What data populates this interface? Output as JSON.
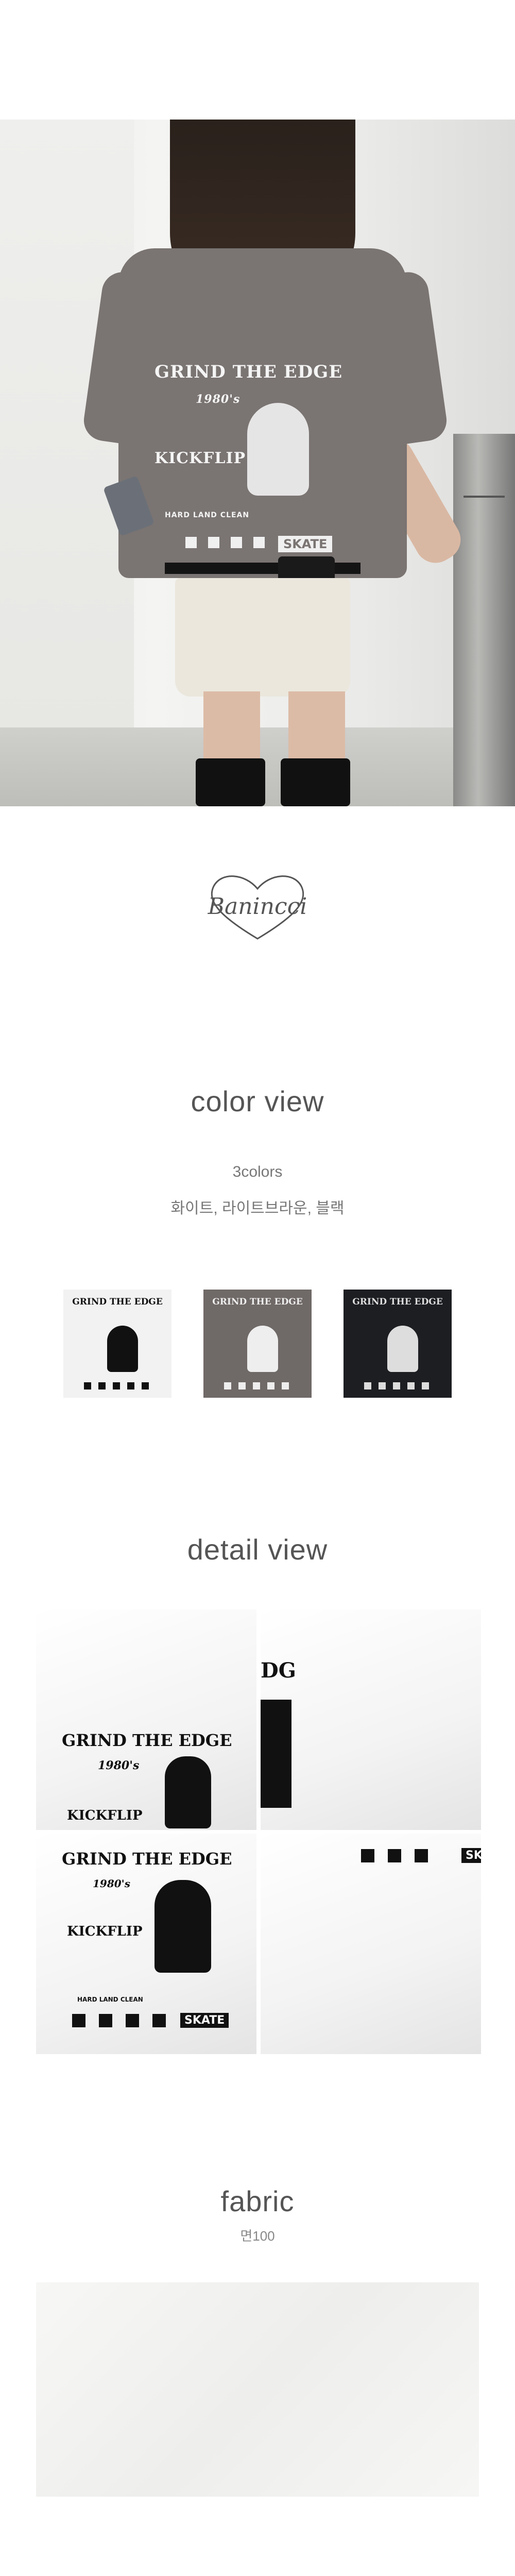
{
  "hero": {
    "print": {
      "headline": "GRIND THE EDGE",
      "year": "1980's",
      "trick": "KICKFLIP",
      "badge": "SKATE",
      "small": "HARD  LAND CLEAN"
    }
  },
  "brand": {
    "logo_text": "Banincci"
  },
  "color_view": {
    "title": "color view",
    "count": "3colors",
    "names": "화이트, 라이트브라운, 블랙",
    "swatches": [
      {
        "name": "white",
        "bg": "#f2f2f2",
        "ink": "#111111"
      },
      {
        "name": "light-brown",
        "bg": "#6f6967",
        "ink": "#eeeeee"
      },
      {
        "name": "black",
        "bg": "#1d1e22",
        "ink": "#dddddd"
      }
    ],
    "swatch_print": "GRIND THE EDGE"
  },
  "detail_view": {
    "title": "detail view",
    "print_headline": "GRIND THE EDGE",
    "print_year": "1980's",
    "print_trick": "KICKFLIP",
    "print_badge": "SKATE",
    "print_small": "HARD  LAND CLEAN",
    "crop_letters": "DG"
  },
  "fabric": {
    "title": "fabric",
    "composition": "면100"
  }
}
